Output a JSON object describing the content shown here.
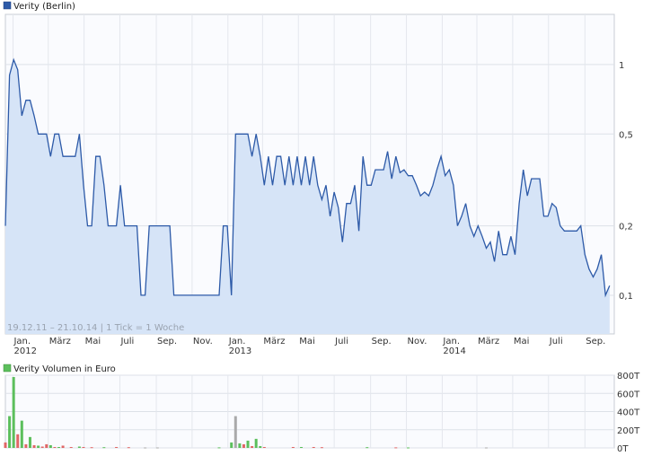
{
  "chart_data": [
    {
      "type": "area",
      "legend": "Verity (Berlin)",
      "footer": "19.12.11 – 21.10.14 | 1 Tick = 1 Woche",
      "scale": "log",
      "ylim": [
        0.068,
        1.65
      ],
      "yticks": [
        {
          "v": 1,
          "label": "1"
        },
        {
          "v": 0.5,
          "label": "0,5"
        },
        {
          "v": 0.2,
          "label": "0,2"
        },
        {
          "v": 0.1,
          "label": "0,1"
        }
      ],
      "xlim": [
        "2011-12-19",
        "2014-10-21"
      ],
      "xticks": [
        {
          "date": "2012-01-01",
          "label": "Jan.",
          "year": "2012"
        },
        {
          "date": "2012-03-01",
          "label": "März"
        },
        {
          "date": "2012-05-01",
          "label": "Mai"
        },
        {
          "date": "2012-07-01",
          "label": "Juli"
        },
        {
          "date": "2012-09-01",
          "label": "Sep."
        },
        {
          "date": "2012-11-01",
          "label": "Nov."
        },
        {
          "date": "2013-01-01",
          "label": "Jan.",
          "year": "2013"
        },
        {
          "date": "2013-03-01",
          "label": "März"
        },
        {
          "date": "2013-05-01",
          "label": "Mai"
        },
        {
          "date": "2013-07-01",
          "label": "Juli"
        },
        {
          "date": "2013-09-01",
          "label": "Sep."
        },
        {
          "date": "2013-11-01",
          "label": "Nov."
        },
        {
          "date": "2014-01-01",
          "label": "Jan.",
          "year": "2014"
        },
        {
          "date": "2014-03-01",
          "label": "März"
        },
        {
          "date": "2014-05-01",
          "label": "Mai"
        },
        {
          "date": "2014-07-01",
          "label": "Juli"
        },
        {
          "date": "2014-09-01",
          "label": "Sep."
        }
      ],
      "series": [
        {
          "name": "Verity (Berlin)",
          "color": "#2d5aa8",
          "fill": "#d6e4f7",
          "points": [
            [
              "2011-12-19",
              0.2
            ],
            [
              "2011-12-26",
              0.9
            ],
            [
              "2012-01-02",
              1.05
            ],
            [
              "2012-01-09",
              0.95
            ],
            [
              "2012-01-16",
              0.6
            ],
            [
              "2012-01-23",
              0.7
            ],
            [
              "2012-01-30",
              0.7
            ],
            [
              "2012-02-06",
              0.6
            ],
            [
              "2012-02-13",
              0.5
            ],
            [
              "2012-02-20",
              0.5
            ],
            [
              "2012-02-27",
              0.5
            ],
            [
              "2012-03-05",
              0.4
            ],
            [
              "2012-03-12",
              0.5
            ],
            [
              "2012-03-19",
              0.5
            ],
            [
              "2012-03-26",
              0.4
            ],
            [
              "2012-04-02",
              0.4
            ],
            [
              "2012-04-09",
              0.4
            ],
            [
              "2012-04-16",
              0.4
            ],
            [
              "2012-04-23",
              0.5
            ],
            [
              "2012-04-30",
              0.3
            ],
            [
              "2012-05-07",
              0.2
            ],
            [
              "2012-05-14",
              0.2
            ],
            [
              "2012-05-21",
              0.4
            ],
            [
              "2012-05-28",
              0.4
            ],
            [
              "2012-06-04",
              0.3
            ],
            [
              "2012-06-11",
              0.2
            ],
            [
              "2012-06-18",
              0.2
            ],
            [
              "2012-06-25",
              0.2
            ],
            [
              "2012-07-02",
              0.3
            ],
            [
              "2012-07-09",
              0.2
            ],
            [
              "2012-07-16",
              0.2
            ],
            [
              "2012-07-23",
              0.2
            ],
            [
              "2012-07-30",
              0.2
            ],
            [
              "2012-08-06",
              0.1
            ],
            [
              "2012-08-13",
              0.1
            ],
            [
              "2012-08-20",
              0.2
            ],
            [
              "2012-08-27",
              0.2
            ],
            [
              "2012-09-03",
              0.2
            ],
            [
              "2012-09-10",
              0.2
            ],
            [
              "2012-09-17",
              0.2
            ],
            [
              "2012-09-24",
              0.2
            ],
            [
              "2012-10-01",
              0.1
            ],
            [
              "2012-10-08",
              0.1
            ],
            [
              "2012-10-15",
              0.1
            ],
            [
              "2012-10-22",
              0.1
            ],
            [
              "2012-10-29",
              0.1
            ],
            [
              "2012-11-05",
              0.1
            ],
            [
              "2012-11-12",
              0.1
            ],
            [
              "2012-11-19",
              0.1
            ],
            [
              "2012-11-26",
              0.1
            ],
            [
              "2012-12-03",
              0.1
            ],
            [
              "2012-12-10",
              0.1
            ],
            [
              "2012-12-17",
              0.1
            ],
            [
              "2012-12-24",
              0.2
            ],
            [
              "2012-12-31",
              0.2
            ],
            [
              "2013-01-07",
              0.1
            ],
            [
              "2013-01-14",
              0.5
            ],
            [
              "2013-01-21",
              0.5
            ],
            [
              "2013-01-28",
              0.5
            ],
            [
              "2013-02-04",
              0.5
            ],
            [
              "2013-02-11",
              0.4
            ],
            [
              "2013-02-18",
              0.5
            ],
            [
              "2013-02-25",
              0.4
            ],
            [
              "2013-03-04",
              0.3
            ],
            [
              "2013-03-11",
              0.4
            ],
            [
              "2013-03-18",
              0.3
            ],
            [
              "2013-03-25",
              0.4
            ],
            [
              "2013-04-01",
              0.4
            ],
            [
              "2013-04-08",
              0.3
            ],
            [
              "2013-04-15",
              0.4
            ],
            [
              "2013-04-22",
              0.3
            ],
            [
              "2013-04-29",
              0.4
            ],
            [
              "2013-05-06",
              0.3
            ],
            [
              "2013-05-13",
              0.4
            ],
            [
              "2013-05-20",
              0.3
            ],
            [
              "2013-05-27",
              0.4
            ],
            [
              "2013-06-03",
              0.3
            ],
            [
              "2013-06-10",
              0.26
            ],
            [
              "2013-06-17",
              0.3
            ],
            [
              "2013-06-24",
              0.22
            ],
            [
              "2013-07-01",
              0.28
            ],
            [
              "2013-07-08",
              0.24
            ],
            [
              "2013-07-15",
              0.17
            ],
            [
              "2013-07-22",
              0.25
            ],
            [
              "2013-07-29",
              0.25
            ],
            [
              "2013-08-05",
              0.3
            ],
            [
              "2013-08-12",
              0.19
            ],
            [
              "2013-08-19",
              0.4
            ],
            [
              "2013-08-26",
              0.3
            ],
            [
              "2013-09-02",
              0.3
            ],
            [
              "2013-09-09",
              0.35
            ],
            [
              "2013-09-16",
              0.35
            ],
            [
              "2013-09-23",
              0.35
            ],
            [
              "2013-09-30",
              0.42
            ],
            [
              "2013-10-07",
              0.32
            ],
            [
              "2013-10-14",
              0.4
            ],
            [
              "2013-10-21",
              0.34
            ],
            [
              "2013-10-28",
              0.35
            ],
            [
              "2013-11-04",
              0.33
            ],
            [
              "2013-11-11",
              0.33
            ],
            [
              "2013-11-18",
              0.3
            ],
            [
              "2013-11-25",
              0.27
            ],
            [
              "2013-12-02",
              0.28
            ],
            [
              "2013-12-09",
              0.27
            ],
            [
              "2013-12-16",
              0.3
            ],
            [
              "2013-12-23",
              0.35
            ],
            [
              "2013-12-30",
              0.4
            ],
            [
              "2014-01-06",
              0.33
            ],
            [
              "2014-01-13",
              0.35
            ],
            [
              "2014-01-20",
              0.3
            ],
            [
              "2014-01-27",
              0.2
            ],
            [
              "2014-02-03",
              0.22
            ],
            [
              "2014-02-10",
              0.25
            ],
            [
              "2014-02-17",
              0.2
            ],
            [
              "2014-02-24",
              0.18
            ],
            [
              "2014-03-03",
              0.2
            ],
            [
              "2014-03-10",
              0.18
            ],
            [
              "2014-03-17",
              0.16
            ],
            [
              "2014-03-24",
              0.17
            ],
            [
              "2014-03-31",
              0.14
            ],
            [
              "2014-04-07",
              0.19
            ],
            [
              "2014-04-14",
              0.15
            ],
            [
              "2014-04-21",
              0.15
            ],
            [
              "2014-04-28",
              0.18
            ],
            [
              "2014-05-05",
              0.15
            ],
            [
              "2014-05-12",
              0.25
            ],
            [
              "2014-05-19",
              0.35
            ],
            [
              "2014-05-26",
              0.27
            ],
            [
              "2014-06-02",
              0.32
            ],
            [
              "2014-06-09",
              0.32
            ],
            [
              "2014-06-16",
              0.32
            ],
            [
              "2014-06-23",
              0.22
            ],
            [
              "2014-06-30",
              0.22
            ],
            [
              "2014-07-07",
              0.25
            ],
            [
              "2014-07-14",
              0.24
            ],
            [
              "2014-07-21",
              0.2
            ],
            [
              "2014-07-28",
              0.19
            ],
            [
              "2014-08-04",
              0.19
            ],
            [
              "2014-08-11",
              0.19
            ],
            [
              "2014-08-18",
              0.19
            ],
            [
              "2014-08-25",
              0.2
            ],
            [
              "2014-09-01",
              0.15
            ],
            [
              "2014-09-08",
              0.13
            ],
            [
              "2014-09-15",
              0.12
            ],
            [
              "2014-09-22",
              0.13
            ],
            [
              "2014-09-29",
              0.15
            ],
            [
              "2014-10-06",
              0.1
            ],
            [
              "2014-10-13",
              0.11
            ]
          ]
        }
      ]
    },
    {
      "type": "bar",
      "legend": "Verity Volumen in Euro",
      "ylim": [
        0,
        800000
      ],
      "yticks": [
        {
          "v": 800000,
          "label": "800T"
        },
        {
          "v": 600000,
          "label": "600T"
        },
        {
          "v": 400000,
          "label": "400T"
        },
        {
          "v": 200000,
          "label": "200T"
        },
        {
          "v": 0,
          "label": "0T"
        }
      ],
      "colors": {
        "up": "#5cbf5c",
        "down": "#e06666",
        "neutral": "#aaaaaa"
      },
      "bars": [
        [
          "2011-12-19",
          60000,
          "down"
        ],
        [
          "2011-12-26",
          350000,
          "up"
        ],
        [
          "2012-01-02",
          780000,
          "up"
        ],
        [
          "2012-01-09",
          150000,
          "down"
        ],
        [
          "2012-01-16",
          300000,
          "up"
        ],
        [
          "2012-01-23",
          40000,
          "down"
        ],
        [
          "2012-01-30",
          120000,
          "up"
        ],
        [
          "2012-02-06",
          30000,
          "down"
        ],
        [
          "2012-02-13",
          25000,
          "up"
        ],
        [
          "2012-02-20",
          15000,
          "down"
        ],
        [
          "2012-02-27",
          40000,
          "down"
        ],
        [
          "2012-03-05",
          30000,
          "up"
        ],
        [
          "2012-03-12",
          10000,
          "down"
        ],
        [
          "2012-03-19",
          10000,
          "up"
        ],
        [
          "2012-03-26",
          25000,
          "down"
        ],
        [
          "2012-04-09",
          10000,
          "down"
        ],
        [
          "2012-04-23",
          15000,
          "up"
        ],
        [
          "2012-04-30",
          10000,
          "down"
        ],
        [
          "2012-05-14",
          8000,
          "down"
        ],
        [
          "2012-06-04",
          8000,
          "up"
        ],
        [
          "2012-06-25",
          10000,
          "down"
        ],
        [
          "2012-07-16",
          8000,
          "down"
        ],
        [
          "2012-08-13",
          5000,
          "neutral"
        ],
        [
          "2012-09-03",
          5000,
          "neutral"
        ],
        [
          "2012-12-17",
          6000,
          "up"
        ],
        [
          "2013-01-07",
          60000,
          "up"
        ],
        [
          "2013-01-14",
          350000,
          "neutral"
        ],
        [
          "2013-01-21",
          50000,
          "up"
        ],
        [
          "2013-01-28",
          40000,
          "down"
        ],
        [
          "2013-02-04",
          80000,
          "up"
        ],
        [
          "2013-02-11",
          20000,
          "down"
        ],
        [
          "2013-02-18",
          100000,
          "up"
        ],
        [
          "2013-02-25",
          20000,
          "up"
        ],
        [
          "2013-03-04",
          10000,
          "down"
        ],
        [
          "2013-04-22",
          10000,
          "down"
        ],
        [
          "2013-05-06",
          10000,
          "up"
        ],
        [
          "2013-05-27",
          10000,
          "down"
        ],
        [
          "2013-06-10",
          8000,
          "down"
        ],
        [
          "2013-08-26",
          8000,
          "up"
        ],
        [
          "2013-10-14",
          6000,
          "down"
        ],
        [
          "2013-11-04",
          5000,
          "up"
        ],
        [
          "2014-03-17",
          5000,
          "neutral"
        ]
      ]
    }
  ]
}
